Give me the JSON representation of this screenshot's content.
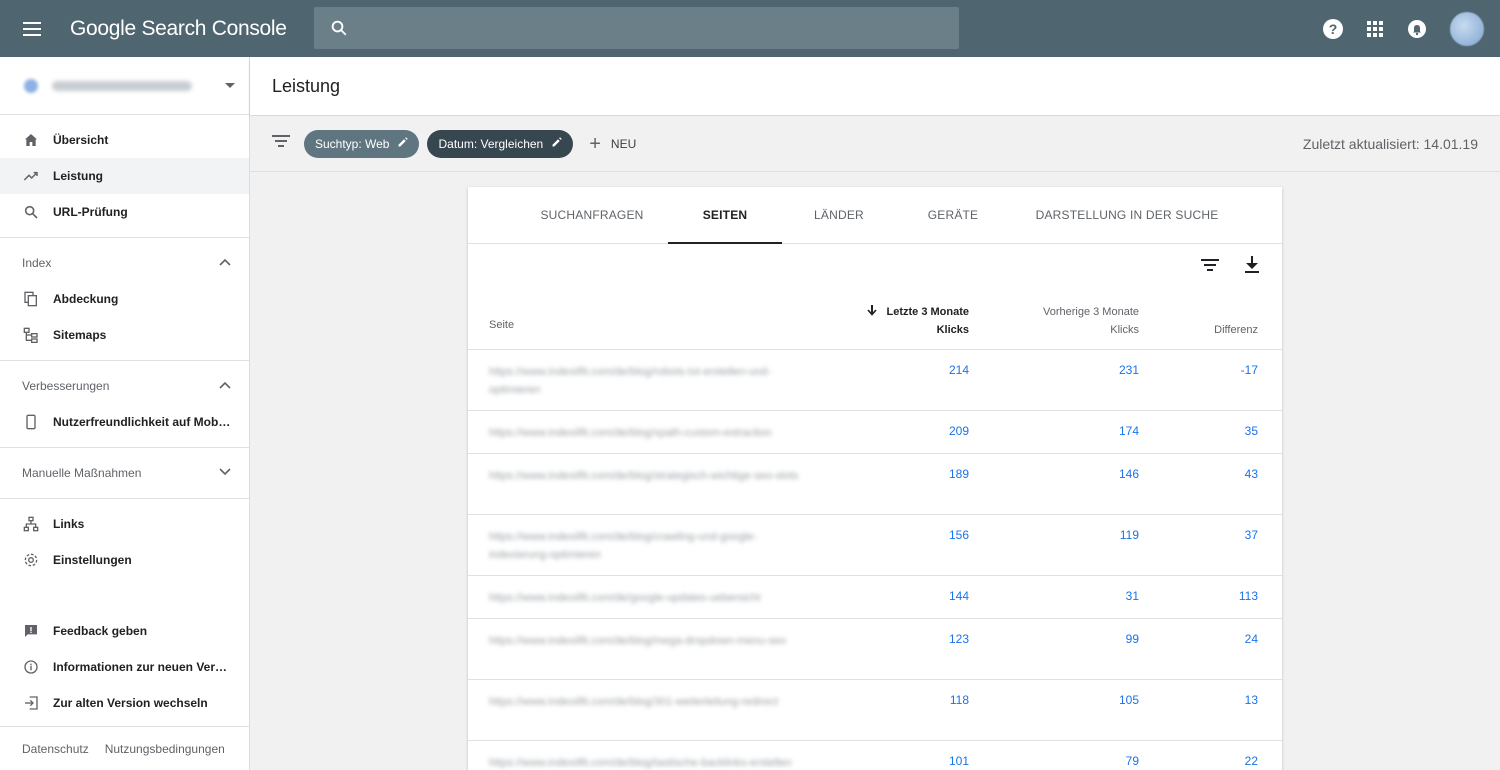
{
  "app": {
    "title": "Google Search Console",
    "search_placeholder": ""
  },
  "header_icons": [
    "help-icon",
    "apps-grid-icon",
    "notifications-icon",
    "account-avatar"
  ],
  "property": {
    "url": "https://www.indexiifit.com/"
  },
  "sidebar": {
    "top_items": [
      {
        "label": "Übersicht",
        "icon": "home-icon"
      },
      {
        "label": "Leistung",
        "icon": "trending-up-icon",
        "active": true
      },
      {
        "label": "URL-Prüfung",
        "icon": "search-icon"
      }
    ],
    "index": {
      "heading": "Index",
      "items": [
        {
          "label": "Abdeckung",
          "icon": "copy-icon"
        },
        {
          "label": "Sitemaps",
          "icon": "sitemap-icon"
        }
      ]
    },
    "improvements": {
      "heading": "Verbesserungen",
      "items": [
        {
          "label": "Nutzerfreundlichkeit auf Mobilg…",
          "icon": "phone-icon"
        }
      ]
    },
    "manual": {
      "heading": "Manuelle Maßnahmen"
    },
    "other_items": [
      {
        "label": "Links",
        "icon": "links-icon"
      },
      {
        "label": "Einstellungen",
        "icon": "gear-icon"
      }
    ],
    "bottom_items": [
      {
        "label": "Feedback geben",
        "icon": "feedback-icon"
      },
      {
        "label": "Informationen zur neuen Version",
        "icon": "info-icon"
      },
      {
        "label": "Zur alten Version wechseln",
        "icon": "exit-icon"
      }
    ],
    "footer": {
      "privacy": "Datenschutz",
      "terms": "Nutzungsbedingungen"
    }
  },
  "page": {
    "title": "Leistung",
    "filters": {
      "chip_type": "Suchtyp: Web",
      "chip_date": "Datum: Vergleichen",
      "new_label": "NEU"
    },
    "updated": "Zuletzt aktualisiert: 14.01.19"
  },
  "card": {
    "tabs": [
      {
        "label": "SUCHANFRAGEN",
        "active": false
      },
      {
        "label": "SEITEN",
        "active": true
      },
      {
        "label": "LÄNDER",
        "active": false
      },
      {
        "label": "GERÄTE",
        "active": false
      },
      {
        "label": "DARSTELLUNG IN DER SUCHE",
        "active": false
      }
    ],
    "columns": {
      "page": "Seite",
      "last3_line1": "Letzte 3 Monate",
      "last3_line2": "Klicks",
      "prev3_line1": "Vorherige 3 Monate",
      "prev3_line2": "Klicks",
      "diff": "Differenz"
    },
    "rows": [
      {
        "url": "https://www.indexiifit.com/de/blog/robots-txt-erstellen-und-optimieren",
        "last": "214",
        "prev": "231",
        "diff": "-17"
      },
      {
        "url": "https://www.indexiifit.com/de/blog/xpath-custom-extraction",
        "last": "209",
        "prev": "174",
        "diff": "35"
      },
      {
        "url": "https://www.indexiifit.com/de/blog/strategisch-wichtige-seo-slots",
        "last": "189",
        "prev": "146",
        "diff": "43"
      },
      {
        "url": "https://www.indexiifit.com/de/blog/crawling-und-google-indexierung-optimieren",
        "last": "156",
        "prev": "119",
        "diff": "37"
      },
      {
        "url": "https://www.indexiifit.com/de/google-updates-uebersicht",
        "last": "144",
        "prev": "31",
        "diff": "113"
      },
      {
        "url": "https://www.indexiifit.com/de/blog/mega-dropdown-menu-seo",
        "last": "123",
        "prev": "99",
        "diff": "24"
      },
      {
        "url": "https://www.indexiifit.com/de/blog/301-weiterleitung-redirect",
        "last": "118",
        "prev": "105",
        "diff": "13"
      },
      {
        "url": "https://www.indexiifit.com/de/blog/tastische-backlinks-erstellen",
        "last": "101",
        "prev": "79",
        "diff": "22"
      }
    ]
  }
}
